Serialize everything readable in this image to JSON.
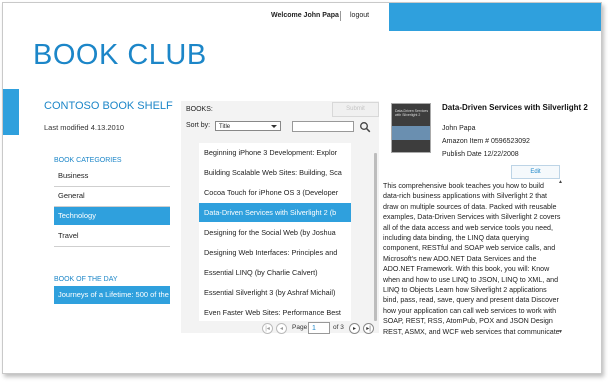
{
  "header": {
    "welcome": "Welcome John Papa",
    "logout": "logout",
    "app_title": "BOOK CLUB"
  },
  "sidebar": {
    "shelf_title": "CONTOSO BOOK SHELF",
    "last_modified": "Last modified 4.13.2010",
    "categories_label": "BOOK CATEGORIES",
    "categories": [
      {
        "label": "Business"
      },
      {
        "label": "General"
      },
      {
        "label": "Technology"
      },
      {
        "label": "Travel"
      }
    ],
    "selected_category": "Technology",
    "book_of_day_label": "BOOK OF THE DAY",
    "book_of_day": "Journeys of a Lifetime: 500 of the"
  },
  "books": {
    "label": "BOOKS:",
    "submit_label": "Submit",
    "sort_label": "Sort by:",
    "sort_value": "Title",
    "search_value": "",
    "items": [
      {
        "title": "Beginning iPhone 3 Development: Explor"
      },
      {
        "title": "Building Scalable Web Sites: Building, Sca"
      },
      {
        "title": "Cocoa Touch for iPhone OS 3 (Developer"
      },
      {
        "title": "Data-Driven Services with Silverlight 2  (b"
      },
      {
        "title": "Designing for the Social Web  (by Joshua"
      },
      {
        "title": "Designing Web Interfaces: Principles and"
      },
      {
        "title": "Essential LINQ  (by Charlie Calvert)"
      },
      {
        "title": "Essential Silverlight 3  (by Ashraf Michail)"
      },
      {
        "title": "Even Faster Web Sites: Performance Best"
      }
    ],
    "selected_index": 3,
    "pager": {
      "page_label": "Page",
      "current_page": "1",
      "of_label": "of 3"
    }
  },
  "detail": {
    "title": "Data-Driven Services with Silverlight 2",
    "author": "John Papa",
    "amazon_item": "Amazon Item # 0596523092",
    "publish_date": "Publish Date 12/22/2008",
    "edit_label": "Edit",
    "cover_text": "Data-Driven Services with Silverlight 2",
    "description": "This comprehensive book teaches you how to build data-rich business applications with Silverlight 2 that draw on multiple sources of data. Packed with reusable examples, Data-Driven Services with Silverlight 2 covers all of the data access and web service tools you need, including data binding, the LINQ data querying component, RESTful and SOAP web service calls, and Microsoft's new ADO.NET Data Services and the ADO.NET Framework. With this book, you will:     Know when and how to use LINQ to JSON, LINQ to XML, and LINQ to Objects    Learn how Silverlight 2 applications bind, pass, read, save, query and present data    Discover how your application can call web services to work with SOAP, REST, RSS, AtomPub, POX and JSON Design REST, ASMX, and WCF web services that communicate"
  },
  "colors": {
    "accent": "#2fa0dd",
    "title_blue": "#1c86c8"
  }
}
